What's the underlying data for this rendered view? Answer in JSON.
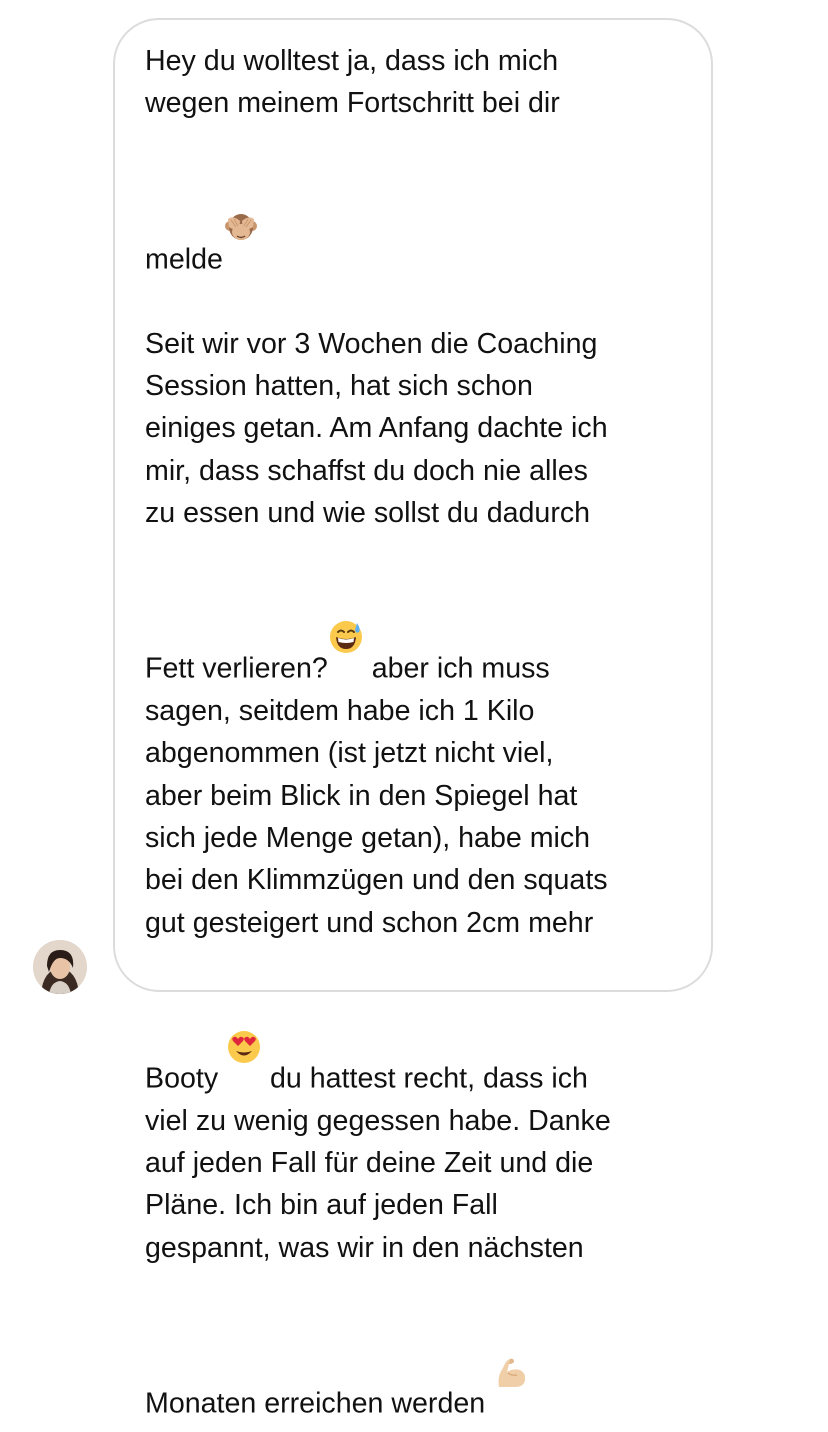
{
  "message": {
    "segments": [
      {
        "text": "Hey du wolltest ja, dass ich mich\nwegen meinem Fortschritt bei dir\nmelde"
      },
      {
        "emoji": "see-no-evil-monkey-emoji"
      },
      {
        "text": "\n\nSeit wir vor 3 Wochen die Coaching\nSession hatten, hat sich schon\neiniges getan. Am Anfang dachte ich\nmir, dass schaffst du doch nie alles\nzu essen und wie sollst du dadurch\nFett verlieren?"
      },
      {
        "emoji": "grinning-sweat-emoji"
      },
      {
        "text": " aber ich muss\nsagen, seitdem habe ich 1 Kilo\nabgenommen (ist jetzt nicht viel,\naber beim Blick in den Spiegel hat\nsich jede Menge getan), habe mich\nbei den Klimmzügen und den squats\ngut gesteigert und schon 2cm mehr\nBooty "
      },
      {
        "emoji": "heart-eyes-emoji"
      },
      {
        "text": " du hattest recht, dass ich\nviel zu wenig gegessen habe. Danke\nauf jeden Fall für deine Zeit und die\nPläne. Ich bin auf jeden Fall\ngespannt, was wir in den nächsten\nMonaten erreichen werden "
      },
      {
        "emoji": "flexed-biceps-emoji"
      }
    ]
  },
  "colors": {
    "text": "#111111",
    "bubble_border": "#dcdcdc",
    "background": "#ffffff"
  }
}
